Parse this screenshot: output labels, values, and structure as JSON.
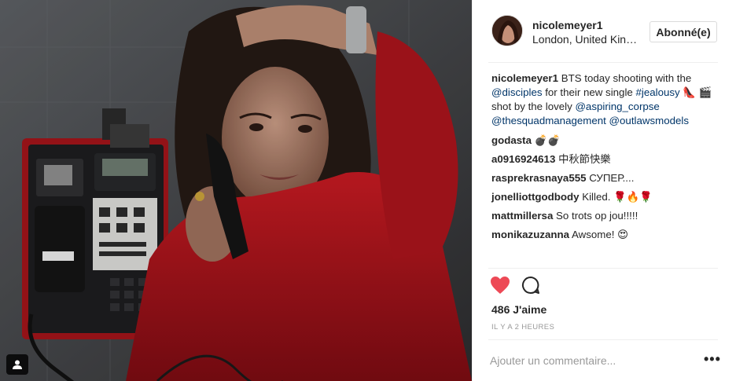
{
  "post": {
    "username": "nicolemeyer1",
    "location": "London, United Kingdom",
    "follow_label": "Abonné(e)",
    "caption": {
      "username": "nicolemeyer1",
      "text_1": " BTS today shooting with the ",
      "mention_1": "@disciples",
      "text_2": " for their new single ",
      "hashtag": "#jealousy",
      "emoji_1": "👠",
      "emoji_2": "🎬",
      "text_3": " shot by the lovely ",
      "mention_2": "@aspiring_corpse",
      "mention_3": "@thesquadmanagement",
      "mention_4": "@outlawsmodels"
    },
    "comments": [
      {
        "user": "godasta",
        "text": "💣💣"
      },
      {
        "user": "a0916924613",
        "text": "中秋節快樂"
      },
      {
        "user": "rasprekrasnaya555",
        "text": "СУПЕР...."
      },
      {
        "user": "jonelliottgodbody",
        "text": "Killed. 🌹🔥🌹"
      },
      {
        "user": "mattmillersa",
        "text": "So trots op jou!!!!!"
      },
      {
        "user": "monikazuzanna",
        "text": "Awsome! 😍"
      }
    ],
    "likes": "486 J'aime",
    "time": "IL Y A 2 HEURES",
    "add_comment_placeholder": "Ajouter un commentaire...",
    "more_label": "•••",
    "colors": {
      "heart": "#ed4956",
      "link": "#003569",
      "coat": "#b3141c"
    },
    "icons": {
      "like": "heart-icon",
      "comment": "comment-bubble-icon",
      "tag": "user-tag-icon"
    }
  }
}
